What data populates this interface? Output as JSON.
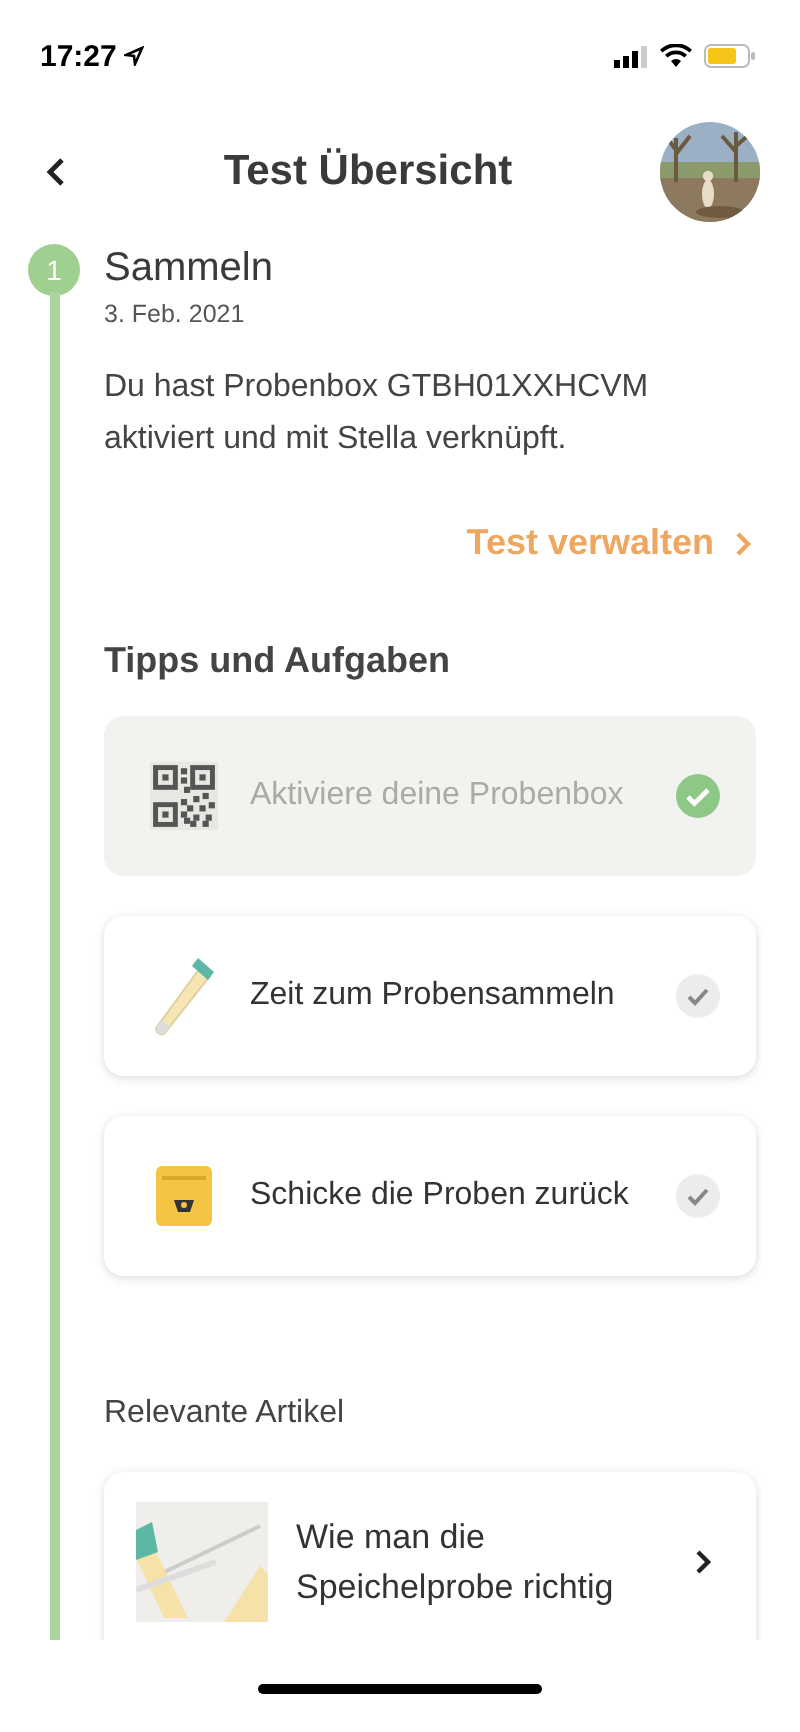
{
  "status_bar": {
    "time": "17:27"
  },
  "header": {
    "title": "Test Übersicht"
  },
  "step": {
    "number": "1",
    "title": "Sammeln",
    "date": "3. Feb. 2021",
    "text": "Du hast Probenbox GTBH01XXHCVM aktiviert und mit Stella verknüpft.",
    "link": "Test verwalten"
  },
  "tasks_heading": "Tipps und Aufgaben",
  "tasks": [
    {
      "kind": "qr",
      "label": "Aktiviere deine Probenbox",
      "completed": true
    },
    {
      "kind": "swab",
      "label": "Zeit zum Probensammeln",
      "completed": false
    },
    {
      "kind": "mailbox",
      "label": "Schicke die Proben zurück",
      "completed": false
    }
  ],
  "articles_heading": "Relevante Artikel",
  "articles": [
    {
      "kind": "picture",
      "title": "Wie man die Speichelprobe richtig"
    }
  ]
}
